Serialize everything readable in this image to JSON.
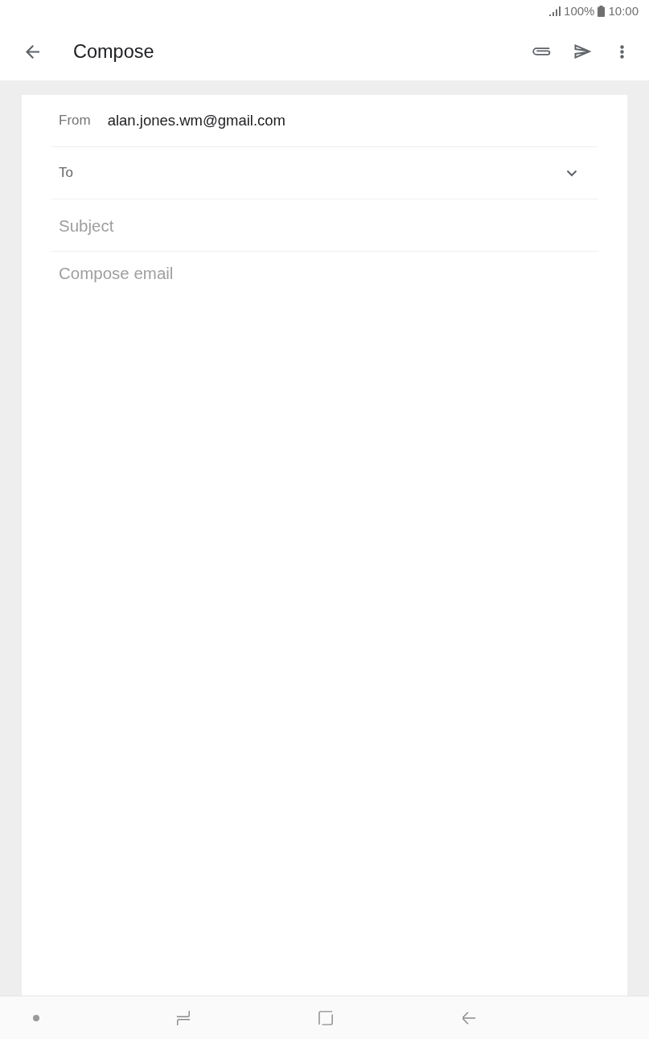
{
  "status_bar": {
    "battery": "100%",
    "time": "10:00"
  },
  "app_bar": {
    "title": "Compose"
  },
  "compose": {
    "from": {
      "label": "From",
      "value": "alan.jones.wm@gmail.com"
    },
    "to": {
      "label": "To"
    },
    "subject": {
      "placeholder": "Subject"
    },
    "body": {
      "placeholder": "Compose email"
    }
  }
}
